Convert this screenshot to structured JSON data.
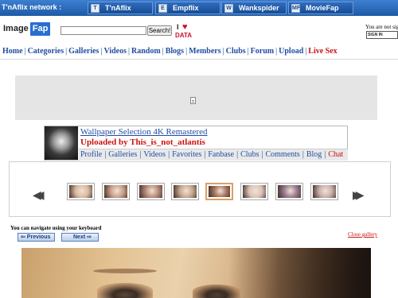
{
  "network": {
    "title": "T'nAflix network :",
    "links": [
      {
        "label": "T'nAflix",
        "icon": "tnaflix-icon",
        "glyph": "T"
      },
      {
        "label": "Empflix",
        "icon": "empflix-icon",
        "glyph": "E"
      },
      {
        "label": "Wankspider",
        "icon": "wankspider-icon",
        "glyph": "W"
      },
      {
        "label": "MovieFap",
        "icon": "moviefap-icon",
        "glyph": "MF"
      }
    ]
  },
  "header": {
    "logo_part1": "Image",
    "logo_part2": "Fap",
    "search_value": "",
    "search_button": "Search!",
    "ilovedata_i": "I",
    "ilovedata_heart": "♥",
    "ilovedata_data": "DATA",
    "signin_text": "You are not signed in",
    "signin_button": "SIGN IN"
  },
  "nav": {
    "items": [
      "Home",
      "Categories",
      "Galleries",
      "Videos",
      "Random",
      "Blogs",
      "Members",
      "Clubs",
      "Forum",
      "Upload",
      "Live Sex"
    ],
    "separator": "|"
  },
  "gallery": {
    "title": "Wallpaper Selection 4K Remastered",
    "uploaded_by": "Uploaded by This_is_not_atlantis",
    "user_links": [
      "Profile",
      "Galleries",
      "Videos",
      "Favorites",
      "Fanbase",
      "Clubs",
      "Comments",
      "Blog",
      "Chat"
    ],
    "prev_arrow": "◀◀",
    "next_arrow": "▶▶",
    "thumbnails": [
      {
        "selected": false,
        "color": "#d9b9a0"
      },
      {
        "selected": false,
        "color": "#c9a08a"
      },
      {
        "selected": false,
        "color": "#b88a78"
      },
      {
        "selected": false,
        "color": "#c7a790"
      },
      {
        "selected": true,
        "color": "#a87860"
      },
      {
        "selected": false,
        "color": "#dcc4b8"
      },
      {
        "selected": false,
        "color": "#9a7a90"
      },
      {
        "selected": false,
        "color": "#c8b0a8"
      }
    ]
  },
  "viewer": {
    "keyboard_hint": "You can navigate using your keyboard",
    "previous_label": "⇦ Previous",
    "next_label": "Next ⇨",
    "close_gallery": "Close gallery"
  },
  "colors": {
    "link_blue": "#1f4ea3",
    "accent_red": "#cc1111",
    "network_bar": "#1d5aa6"
  }
}
